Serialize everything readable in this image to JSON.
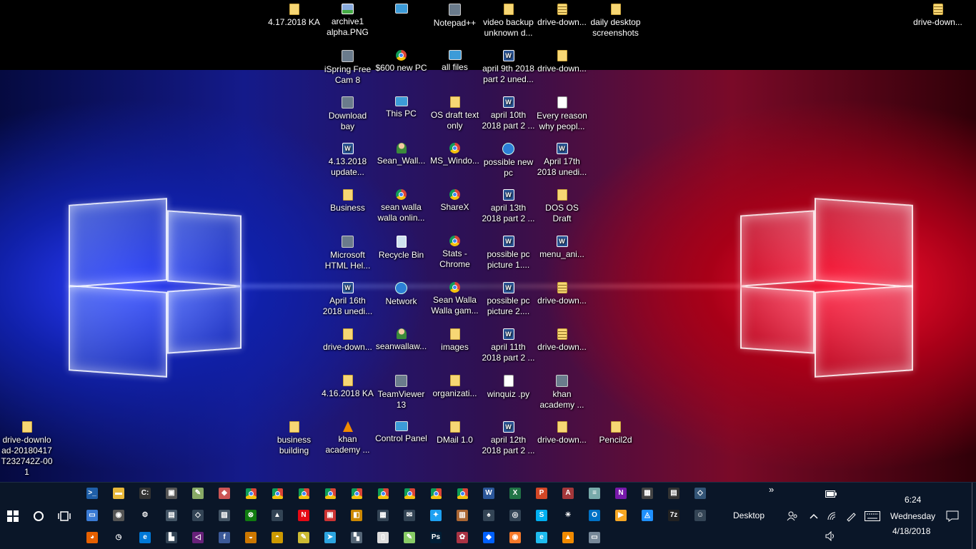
{
  "desktop_icons": [
    {
      "label": "4.17.2018 KA",
      "type": "folder"
    },
    {
      "label": "archive1 alpha.PNG",
      "type": "img"
    },
    {
      "label": "",
      "type": "monitor"
    },
    {
      "label": "Notepad++",
      "type": "app"
    },
    {
      "label": "video backup unknown d...",
      "type": "folder"
    },
    {
      "label": "drive-down...",
      "type": "zip"
    },
    {
      "label": "daily desktop screenshots",
      "type": "folder"
    },
    {
      "label": "drive-down...",
      "type": "zip"
    },
    {
      "label": "iSpring Free Cam 8",
      "type": "app"
    },
    {
      "label": "$600 new PC",
      "type": "chrome"
    },
    {
      "label": "all files",
      "type": "monitor"
    },
    {
      "label": "april 9th 2018 part 2 uned...",
      "type": "word"
    },
    {
      "label": "drive-down...",
      "type": "folder"
    },
    {
      "label": "Download bay",
      "type": "app"
    },
    {
      "label": "This PC",
      "type": "monitor"
    },
    {
      "label": "OS draft text only",
      "type": "folder"
    },
    {
      "label": "april 10th 2018 part 2 ...",
      "type": "word"
    },
    {
      "label": "Every reason why peopl...",
      "type": "doc"
    },
    {
      "label": "4.13.2018 update...",
      "type": "word"
    },
    {
      "label": "Sean_Wall...",
      "type": "person"
    },
    {
      "label": "MS_Windo...",
      "type": "chrome"
    },
    {
      "label": "possible new pc",
      "type": "globe"
    },
    {
      "label": "April 17th 2018 unedi...",
      "type": "word"
    },
    {
      "label": "Business",
      "type": "folder"
    },
    {
      "label": "sean walla walla onlin...",
      "type": "chrome"
    },
    {
      "label": "ShareX",
      "type": "chrome"
    },
    {
      "label": "april 13th 2018 part 2 ...",
      "type": "word"
    },
    {
      "label": "DOS OS Draft",
      "type": "folder"
    },
    {
      "label": "Microsoft HTML Hel...",
      "type": "app"
    },
    {
      "label": "Recycle Bin",
      "type": "bin"
    },
    {
      "label": "Stats - Chrome",
      "type": "chrome"
    },
    {
      "label": "possible pc picture 1....",
      "type": "word"
    },
    {
      "label": "menu_ani...",
      "type": "word"
    },
    {
      "label": "April 16th 2018 unedi...",
      "type": "word"
    },
    {
      "label": "Network",
      "type": "globe"
    },
    {
      "label": "Sean Walla Walla gam...",
      "type": "chrome"
    },
    {
      "label": "possible pc picture 2....",
      "type": "word"
    },
    {
      "label": "drive-down...",
      "type": "zip"
    },
    {
      "label": "drive-down...",
      "type": "folder"
    },
    {
      "label": "seanwallaw...",
      "type": "person"
    },
    {
      "label": "images",
      "type": "folder"
    },
    {
      "label": "april 11th 2018 part 2 ...",
      "type": "word"
    },
    {
      "label": "drive-down...",
      "type": "zip"
    },
    {
      "label": "4.16.2018 KA",
      "type": "folder"
    },
    {
      "label": "TeamViewer 13",
      "type": "app"
    },
    {
      "label": "organizati...",
      "type": "folder"
    },
    {
      "label": "winquiz .py",
      "type": "doc"
    },
    {
      "label": "khan academy ...",
      "type": "app"
    },
    {
      "label": "drive-downlo ad-20180417 T232742Z-00 1",
      "type": "folder"
    },
    {
      "label": "business building",
      "type": "folder"
    },
    {
      "label": "khan academy ...",
      "type": "cone"
    },
    {
      "label": "Control Panel",
      "type": "monitor"
    },
    {
      "label": "DMail 1.0",
      "type": "folder"
    },
    {
      "label": "april 12th 2018 part 2 ...",
      "type": "word"
    },
    {
      "label": "drive-down...",
      "type": "folder"
    },
    {
      "label": "Pencil2d",
      "type": "folder"
    }
  ],
  "taskbar": {
    "start_icon": "windows-logo-icon",
    "cortana_icon": "cortana-circle-icon",
    "taskview_icon": "task-view-icon",
    "row1": [
      {
        "name": "powershell-icon",
        "glyph": ">_",
        "color": "#1f5fa8"
      },
      {
        "name": "file-explorer-icon",
        "glyph": "▬",
        "color": "#e8b83a"
      },
      {
        "name": "command-prompt-icon",
        "glyph": "C:",
        "color": "#333"
      },
      {
        "name": "store-icon",
        "glyph": "▣",
        "color": "#555"
      },
      {
        "name": "paint-icon",
        "glyph": "✎",
        "color": "#8a6"
      },
      {
        "name": "maps-pin-icon",
        "glyph": "◆",
        "color": "#c55"
      },
      {
        "name": "chrome-icon",
        "glyph": "",
        "color": "chrome"
      },
      {
        "name": "chrome-icon",
        "glyph": "",
        "color": "chrome"
      },
      {
        "name": "chrome-icon",
        "glyph": "",
        "color": "chrome"
      },
      {
        "name": "chrome-icon",
        "glyph": "",
        "color": "chrome"
      },
      {
        "name": "chrome-icon",
        "glyph": "",
        "color": "chrome"
      },
      {
        "name": "chrome-icon",
        "glyph": "",
        "color": "chrome"
      },
      {
        "name": "chrome-icon",
        "glyph": "",
        "color": "chrome"
      },
      {
        "name": "chrome-icon",
        "glyph": "",
        "color": "chrome"
      },
      {
        "name": "chrome-icon",
        "glyph": "",
        "color": "chrome"
      },
      {
        "name": "word-icon",
        "glyph": "W",
        "color": "#2b579a"
      },
      {
        "name": "excel-icon",
        "glyph": "X",
        "color": "#217346"
      },
      {
        "name": "powerpoint-icon",
        "glyph": "P",
        "color": "#d24726"
      },
      {
        "name": "access-icon",
        "glyph": "A",
        "color": "#a4373a"
      },
      {
        "name": "notepad-icon",
        "glyph": "≡",
        "color": "#7aa"
      },
      {
        "name": "onenote-icon",
        "glyph": "N",
        "color": "#7719aa"
      },
      {
        "name": "calculator-icon",
        "glyph": "▦",
        "color": "#444"
      },
      {
        "name": "movie-maker-icon",
        "glyph": "▤",
        "color": "#333"
      },
      {
        "name": "3d-builder-icon",
        "glyph": "◇",
        "color": "#357"
      }
    ],
    "row2": [
      {
        "name": "remote-desktop-icon",
        "glyph": "▭",
        "color": "#3a7bd5"
      },
      {
        "name": "mixed-reality-icon",
        "glyph": "◉",
        "color": "#555"
      },
      {
        "name": "settings-gear-icon",
        "glyph": "⚙",
        "color": "transparent"
      },
      {
        "name": "document-icon",
        "glyph": "▤",
        "color": "#456"
      },
      {
        "name": "3d-viewer-icon",
        "glyph": "◇",
        "color": "#345"
      },
      {
        "name": "photos-app-icon",
        "glyph": "▨",
        "color": "#456"
      },
      {
        "name": "xbox-icon",
        "glyph": "⊗",
        "color": "#107c10"
      },
      {
        "name": "photos-icon",
        "glyph": "▲",
        "color": "#345"
      },
      {
        "name": "netflix-icon",
        "glyph": "N",
        "color": "#e50914"
      },
      {
        "name": "news-icon",
        "glyph": "▣",
        "color": "#c33"
      },
      {
        "name": "puzzle-icon",
        "glyph": "◧",
        "color": "#c80"
      },
      {
        "name": "calendar-icon",
        "glyph": "▦",
        "color": "#345"
      },
      {
        "name": "mail-icon",
        "glyph": "✉",
        "color": "#345"
      },
      {
        "name": "twitter-icon",
        "glyph": "✦",
        "color": "#1da1f2"
      },
      {
        "name": "film-icon",
        "glyph": "▥",
        "color": "#a63"
      },
      {
        "name": "solitaire-icon",
        "glyph": "♠",
        "color": "#345"
      },
      {
        "name": "groove-music-icon",
        "glyph": "◎",
        "color": "#345"
      },
      {
        "name": "skype-icon",
        "glyph": "S",
        "color": "#00aff0"
      },
      {
        "name": "weather-icon",
        "glyph": "☀",
        "color": "transparent"
      },
      {
        "name": "outlook-icon",
        "glyph": "O",
        "color": "#0072c6"
      },
      {
        "name": "video-player-icon",
        "glyph": "▶",
        "color": "#f5a623"
      },
      {
        "name": "network-share-icon",
        "glyph": "◬",
        "color": "#1e90ff"
      },
      {
        "name": "7zip-icon",
        "glyph": "7z",
        "color": "#222"
      },
      {
        "name": "people-share-icon",
        "glyph": "☺",
        "color": "#345"
      }
    ],
    "row3": [
      {
        "name": "firefox-icon",
        "glyph": "◕",
        "color": "#e66000"
      },
      {
        "name": "alarm-clock-icon",
        "glyph": "◷",
        "color": "transparent"
      },
      {
        "name": "edge-icon",
        "glyph": "e",
        "color": "#0078d7"
      },
      {
        "name": "sticky-notes-icon",
        "glyph": "▙",
        "color": "#345"
      },
      {
        "name": "visual-studio-icon",
        "glyph": "◁",
        "color": "#68217a"
      },
      {
        "name": "facebook-icon",
        "glyph": "f",
        "color": "#3b5998"
      },
      {
        "name": "game-cat-icon",
        "glyph": "◒",
        "color": "#c70"
      },
      {
        "name": "game-tiger-icon",
        "glyph": "◓",
        "color": "#c90"
      },
      {
        "name": "pencil2d-icon",
        "glyph": "✎",
        "color": "#cb3"
      },
      {
        "name": "telegram-icon",
        "glyph": "➤",
        "color": "#2ca5e0"
      },
      {
        "name": "vmware-icon",
        "glyph": "▚",
        "color": "#567"
      },
      {
        "name": "blank-document-icon",
        "glyph": "▯",
        "color": "#ddd"
      },
      {
        "name": "notepad-plus-icon",
        "glyph": "✎",
        "color": "#8c6"
      },
      {
        "name": "photoshop-icon",
        "glyph": "Ps",
        "color": "#001e36"
      },
      {
        "name": "palette-icon",
        "glyph": "✿",
        "color": "#a34"
      },
      {
        "name": "dropbox-icon",
        "glyph": "◆",
        "color": "#0061ff"
      },
      {
        "name": "blender-icon",
        "glyph": "◉",
        "color": "#f5792a"
      },
      {
        "name": "internet-explorer-icon",
        "glyph": "e",
        "color": "#1ebbee"
      },
      {
        "name": "vlc-icon",
        "glyph": "▲",
        "color": "#f08a00"
      },
      {
        "name": "printer-icon",
        "glyph": "▭",
        "color": "#789"
      }
    ],
    "desktop_label": "Desktop",
    "overflow_label": "»",
    "clock_time": "6:24",
    "clock_day": "Wednesday",
    "clock_date": "4/18/2018"
  }
}
